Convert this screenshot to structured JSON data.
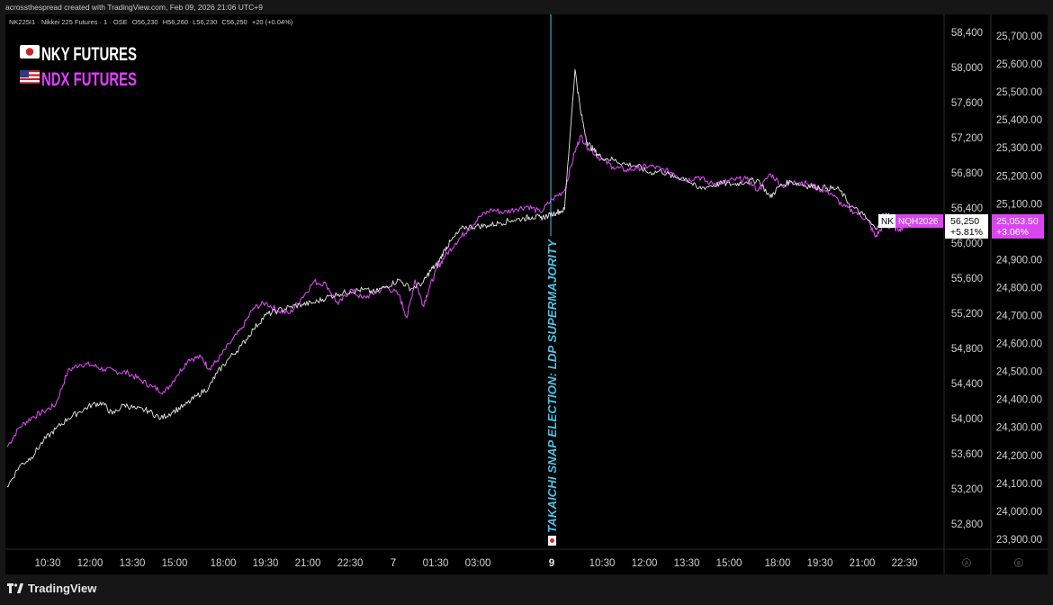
{
  "attribution": "acrossthespread created with TradingView.com, Feb 09, 2026 21:06 UTC+9",
  "symbol_header": {
    "symbol": "NK225I1 · Nikkei 225 Futures · 1 · OSE",
    "open": "O56,230",
    "high": "H56,260",
    "low": "L56,230",
    "close": "C56,250",
    "change": "+20 (+0.04%)"
  },
  "brand": "TradingView",
  "legend": [
    {
      "flag": "japan-flag",
      "label": "NKY FUTURES",
      "color": "#ffffff"
    },
    {
      "flag": "usa-flag",
      "label": "NDX FUTURES",
      "color": "#e040fb"
    }
  ],
  "annotation": {
    "text": "TAKAICHI SNAP ELECTION: LDP SUPERMAJORITY",
    "color": "#4fc3e8",
    "flag": "japan-flag"
  },
  "scale_labels": {
    "left": "A",
    "right": "B"
  },
  "colors": {
    "background": "#000000",
    "panel": "#161616",
    "nky": "#e8e8e8",
    "ndx": "#d946ef",
    "event_line": "#4fc3e8"
  },
  "chart_data": {
    "type": "line",
    "x_ticks": [
      "10:30",
      "12:00",
      "13:30",
      "15:00",
      "18:00",
      "19:30",
      "21:00",
      "22:30",
      "7",
      "01:30",
      "03:00",
      "9",
      "10:30",
      "12:00",
      "13:30",
      "15:00",
      "18:00",
      "19:30",
      "21:00",
      "22:30"
    ],
    "y_axes": {
      "nky": {
        "ticks": [
          "58,400",
          "58,000",
          "57,600",
          "57,200",
          "56,800",
          "56,400",
          "56,000",
          "55,600",
          "55,200",
          "54,800",
          "54,400",
          "54,000",
          "53,600",
          "53,200",
          "52,800"
        ],
        "ylim": [
          52500,
          58600
        ]
      },
      "ndx": {
        "ticks": [
          "25,700.00",
          "25,600.00",
          "25,500.00",
          "25,400.00",
          "25,300.00",
          "25,200.00",
          "25,100.00",
          "25,000.00",
          "24,900.00",
          "24,800.00",
          "24,700.00",
          "24,600.00",
          "24,500.00",
          "24,400.00",
          "24,300.00",
          "24,200.00",
          "24,100.00",
          "24,000.00",
          "23,900.00"
        ]
      }
    },
    "series": [
      {
        "name": "NK",
        "axis": "nky",
        "last_value": "56,250",
        "last_change": "+5.81%",
        "points": [
          [
            0,
            53220
          ],
          [
            1.5,
            53460
          ],
          [
            3,
            53560
          ],
          [
            4.5,
            53750
          ],
          [
            6,
            53880
          ],
          [
            7.5,
            54000
          ],
          [
            9,
            54080
          ],
          [
            10.5,
            54160
          ],
          [
            11.8,
            54180
          ],
          [
            13,
            54050
          ],
          [
            14.5,
            54160
          ],
          [
            16,
            54110
          ],
          [
            17.5,
            54090
          ],
          [
            19,
            54000
          ],
          [
            20.5,
            54080
          ],
          [
            22,
            54150
          ],
          [
            23.5,
            54260
          ],
          [
            25,
            54360
          ],
          [
            26,
            54520
          ],
          [
            27.5,
            54690
          ],
          [
            29,
            54830
          ],
          [
            30.5,
            55020
          ],
          [
            32,
            55180
          ],
          [
            33.5,
            55230
          ],
          [
            35,
            55270
          ],
          [
            36.5,
            55300
          ],
          [
            38,
            55320
          ],
          [
            39.5,
            55380
          ],
          [
            41,
            55420
          ],
          [
            42.5,
            55450
          ],
          [
            44,
            55470
          ],
          [
            45.5,
            55440
          ],
          [
            47,
            55510
          ],
          [
            48.5,
            55580
          ],
          [
            50,
            55480
          ],
          [
            51.5,
            55550
          ],
          [
            52.5,
            55700
          ],
          [
            53.3,
            55760
          ],
          [
            54.2,
            55930
          ],
          [
            55,
            56030
          ],
          [
            56.5,
            56180
          ],
          [
            58,
            56190
          ],
          [
            59.5,
            56200
          ],
          [
            61,
            56230
          ],
          [
            62.5,
            56260
          ],
          [
            64,
            56280
          ],
          [
            65,
            56300
          ],
          [
            66,
            56290
          ],
          [
            67,
            56310
          ],
          [
            68,
            56350
          ],
          [
            69,
            56380
          ],
          [
            70.3,
            57980
          ],
          [
            71,
            57500
          ],
          [
            71.8,
            57150
          ],
          [
            72.6,
            57060
          ],
          [
            73.5,
            56980
          ],
          [
            75,
            56950
          ],
          [
            76.5,
            56900
          ],
          [
            78,
            56880
          ],
          [
            79.5,
            56800
          ],
          [
            81,
            56820
          ],
          [
            82.5,
            56750
          ],
          [
            84,
            56740
          ],
          [
            85.5,
            56620
          ],
          [
            87,
            56650
          ],
          [
            88.5,
            56680
          ],
          [
            90,
            56670
          ],
          [
            91.5,
            56700
          ],
          [
            93,
            56720
          ],
          [
            94.5,
            56520
          ],
          [
            95.5,
            56640
          ],
          [
            97,
            56700
          ],
          [
            98.5,
            56660
          ],
          [
            100,
            56640
          ],
          [
            101.5,
            56630
          ],
          [
            103,
            56610
          ],
          [
            104.5,
            56420
          ],
          [
            106,
            56320
          ],
          [
            107.5,
            56160
          ],
          [
            108.5,
            56330
          ],
          [
            109.5,
            56300
          ],
          [
            110.5,
            56240
          ],
          [
            111.5,
            56250
          ]
        ]
      },
      {
        "name": "NQH2026",
        "axis": "ndx",
        "last_value": "25,053.50",
        "last_change": "+3.06%",
        "points": [
          [
            0,
            53680
          ],
          [
            1.5,
            53900
          ],
          [
            3,
            54010
          ],
          [
            4.5,
            54080
          ],
          [
            6,
            54160
          ],
          [
            7.5,
            54540
          ],
          [
            9,
            54620
          ],
          [
            10.5,
            54610
          ],
          [
            12,
            54560
          ],
          [
            13.5,
            54540
          ],
          [
            15,
            54520
          ],
          [
            16.5,
            54440
          ],
          [
            18,
            54360
          ],
          [
            19.5,
            54300
          ],
          [
            21,
            54490
          ],
          [
            22.5,
            54680
          ],
          [
            24,
            54700
          ],
          [
            25,
            54570
          ],
          [
            26,
            54660
          ],
          [
            27.5,
            54850
          ],
          [
            29,
            55020
          ],
          [
            30.5,
            55260
          ],
          [
            32,
            55320
          ],
          [
            33.5,
            55230
          ],
          [
            35,
            55200
          ],
          [
            36.5,
            55380
          ],
          [
            38,
            55560
          ],
          [
            39.5,
            55530
          ],
          [
            41,
            55300
          ],
          [
            42.5,
            55470
          ],
          [
            44,
            55370
          ],
          [
            45.5,
            55430
          ],
          [
            47,
            55500
          ],
          [
            48.5,
            55410
          ],
          [
            49.5,
            55150
          ],
          [
            50.5,
            55580
          ],
          [
            51.5,
            55290
          ],
          [
            52.3,
            55500
          ],
          [
            53.3,
            55720
          ],
          [
            54.2,
            55850
          ],
          [
            55.5,
            56000
          ],
          [
            57,
            56150
          ],
          [
            58.5,
            56300
          ],
          [
            60,
            56380
          ],
          [
            61.5,
            56350
          ],
          [
            63,
            56390
          ],
          [
            64.5,
            56420
          ],
          [
            66,
            56350
          ],
          [
            67.5,
            56500
          ],
          [
            69,
            56600
          ],
          [
            70.3,
            57040
          ],
          [
            71,
            57220
          ],
          [
            72,
            57080
          ],
          [
            73.5,
            56960
          ],
          [
            75,
            56870
          ],
          [
            76.5,
            56830
          ],
          [
            78,
            56850
          ],
          [
            79.5,
            56880
          ],
          [
            81,
            56840
          ],
          [
            82.5,
            56800
          ],
          [
            84,
            56710
          ],
          [
            85.5,
            56760
          ],
          [
            87,
            56680
          ],
          [
            88.5,
            56690
          ],
          [
            90,
            56720
          ],
          [
            91.5,
            56730
          ],
          [
            93,
            56600
          ],
          [
            94.5,
            56790
          ],
          [
            96,
            56650
          ],
          [
            97.5,
            56710
          ],
          [
            99,
            56680
          ],
          [
            100.5,
            56620
          ],
          [
            102,
            56570
          ],
          [
            103.5,
            56420
          ],
          [
            105,
            56350
          ],
          [
            106.5,
            56270
          ],
          [
            107.5,
            56070
          ],
          [
            108.5,
            56200
          ],
          [
            109.5,
            56180
          ],
          [
            110.5,
            56160
          ],
          [
            111.5,
            56220
          ]
        ]
      }
    ]
  }
}
